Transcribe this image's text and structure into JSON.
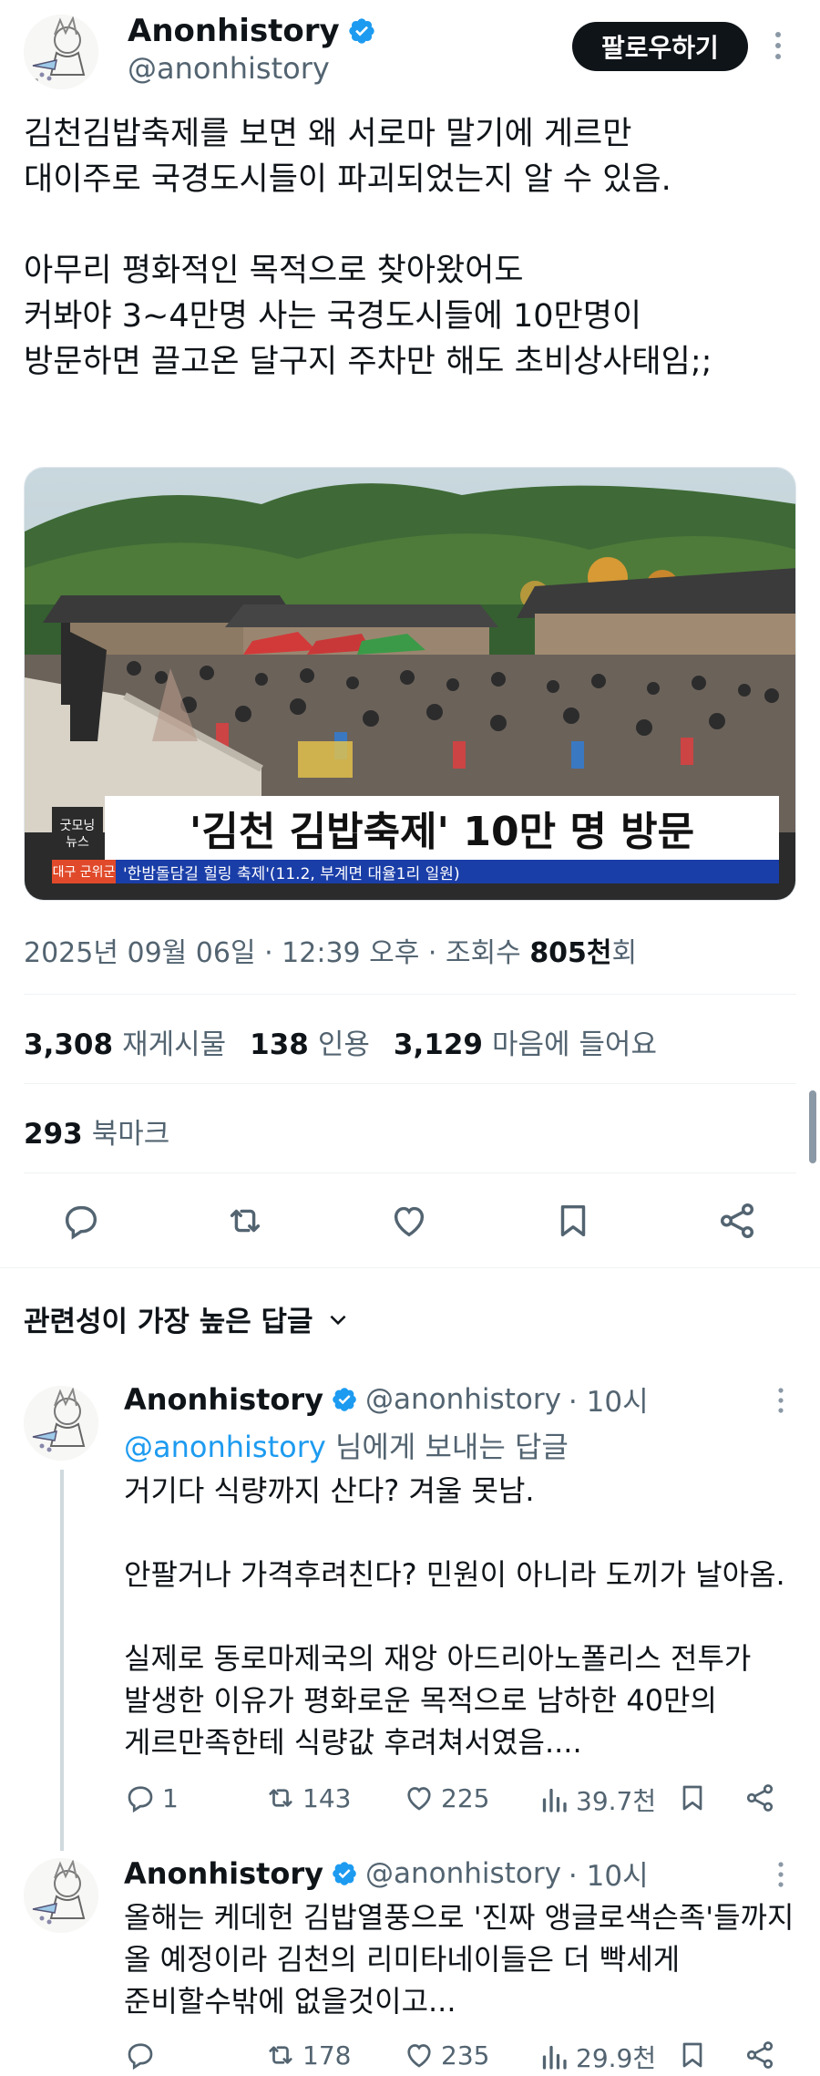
{
  "tweet": {
    "author_name": "Anonhistory",
    "author_handle": "@anonhistory",
    "follow_label": "팔로우하기",
    "text": "김천김밥축제를 보면 왜 서로마 말기에 게르만\n대이주로 국경도시들이 파괴되었는지 알 수 있음.\n\n아무리 평화적인 목적으로 찾아왔어도\n커봐야 3~4만명 사는 국경도시들에 10만명이\n방문하면 끌고온 달구지 주차만 해도 초비상사태임;;",
    "image": {
      "headline": "'김천 김밥축제' 10만 명 방문",
      "logo": "굿모닝\n뉴스",
      "ticker_region": "대구 군위군",
      "ticker_text": "'한밤돌담길 힐링 축제'(11.2, 부계면 대율1리 일원)"
    },
    "timestamp": "2025년 09월 06일 · 12:39 오후 · 조회수 ",
    "views": "805천",
    "views_suffix": "회",
    "stats": {
      "retweets": "3,308",
      "retweets_label": "재게시물",
      "quotes": "138",
      "quotes_label": "인용",
      "likes": "3,129",
      "likes_label": "마음에 들어요",
      "bookmarks": "293",
      "bookmarks_label": "북마크"
    }
  },
  "replies_header": "관련성이 가장 높은 답글",
  "replies": [
    {
      "author_name": "Anonhistory",
      "author_handle": "@anonhistory",
      "time": "· 10시",
      "reply_to_handle": "@anonhistory",
      "reply_to_suffix": " 님에게 보내는 답글",
      "text": "거기다 식량까지 산다? 겨울 못남.\n\n안팔거나 가격후려친다? 민원이 아니라 도끼가 날아옴.\n\n실제로 동로마제국의 재앙 아드리아노폴리스 전투가\n발생한 이유가 평화로운 목적으로 남하한 40만의\n게르만족한테 식량값 후려쳐서였음....",
      "replies": "1",
      "retweets": "143",
      "likes": "225",
      "views": "39.7천"
    },
    {
      "author_name": "Anonhistory",
      "author_handle": "@anonhistory",
      "time": "· 10시",
      "text": "올해는 케데헌 김밥열풍으로 '진짜 앵글로색슨족'들까지\n올 예정이라 김천의 리미타네이들은 더 빡세게\n준비할수밖에 없을것이고...",
      "replies": "",
      "retweets": "178",
      "likes": "235",
      "views": "29.9천"
    }
  ],
  "colors": {
    "verified": "#1d9bf0",
    "link": "#1d9bf0",
    "secondary_text": "#536471",
    "headline_band": "#1a3ea8"
  }
}
